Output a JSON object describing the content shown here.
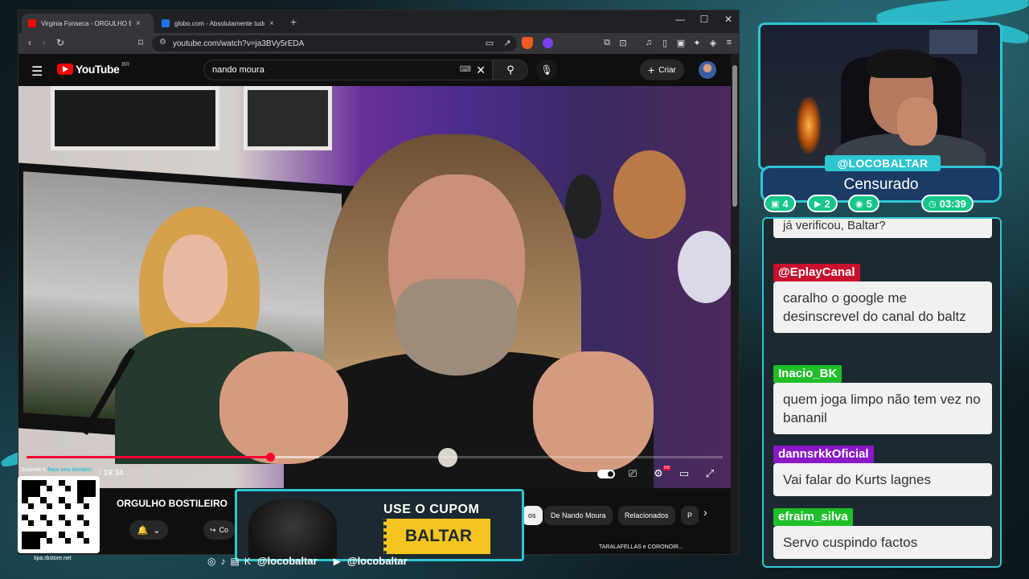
{
  "browser": {
    "tabs": [
      {
        "title": "Virginia Fonseca - ORGULHO BOSTI",
        "close": "×"
      },
      {
        "title": "globo.com - Absolutamente tudo sobre notí",
        "close": "×"
      }
    ],
    "new_tab": "+",
    "window_controls": {
      "minimize": "—",
      "maximize": "☐",
      "close": "✕"
    },
    "url": "youtube.com/watch?v=ja3BVy5rEDA"
  },
  "youtube": {
    "logo": "YouTube",
    "region": "BR",
    "search_value": "nando moura",
    "create_label": "Criar",
    "video": {
      "progress_fraction": 0.35,
      "buffer_fraction": 0.42,
      "time": "/ 19:34"
    },
    "title": "ORGULHO BOSTILEIRO",
    "share_label": "Co",
    "chips": [
      {
        "label": "os",
        "selected": true
      },
      {
        "label": "De Nando Moura",
        "selected": false
      },
      {
        "label": "Relacionados",
        "selected": false
      },
      {
        "label": "P",
        "selected": false
      }
    ],
    "rec_title": "TARALAFELLAS e CORONOIR..."
  },
  "overlay": {
    "coupon_label": "USE O CUPOM",
    "coupon_code": "BALTAR",
    "qr_caption_prefix": "Scaneie e ",
    "qr_caption_highlight": "faça seu donate!",
    "qr_url": "tipa.rbstore.net",
    "social_handle_1": "@locobaltar",
    "social_handle_2": "@locobaltar",
    "streamer_name": "@LOCOBALTAR",
    "status": "Censurado",
    "stats": [
      {
        "icon": "twitch-icon",
        "value": "4",
        "color": "#14c78a"
      },
      {
        "icon": "youtube-icon",
        "value": "2",
        "color": "#14c78a"
      },
      {
        "icon": "kick-icon",
        "value": "5",
        "color": "#14c78a"
      },
      {
        "icon": "clock-icon",
        "value": "03:39",
        "color": "#14c78a"
      }
    ]
  },
  "chat": {
    "truncated": "já verificou, Baltar?",
    "messages": [
      {
        "user": "@EplayCanal",
        "color": "#c8102e",
        "text": "caralho o google me desinscrevel do canal do baltz"
      },
      {
        "user": "Inacio_BK",
        "color": "#1fbf2a",
        "text": "quem joga limpo não tem vez no bananil"
      },
      {
        "user": "dannsrkkOficial",
        "color": "#8a18c7",
        "text": "Vai falar do Kurts lagnes"
      },
      {
        "user": "efraim_silva",
        "color": "#1fbf2a",
        "text": "Servo cuspindo factos"
      }
    ]
  },
  "colors": {
    "accent": "#2ec6d3",
    "coupon": "#f6c41e",
    "youtube_red": "#ff0000"
  }
}
